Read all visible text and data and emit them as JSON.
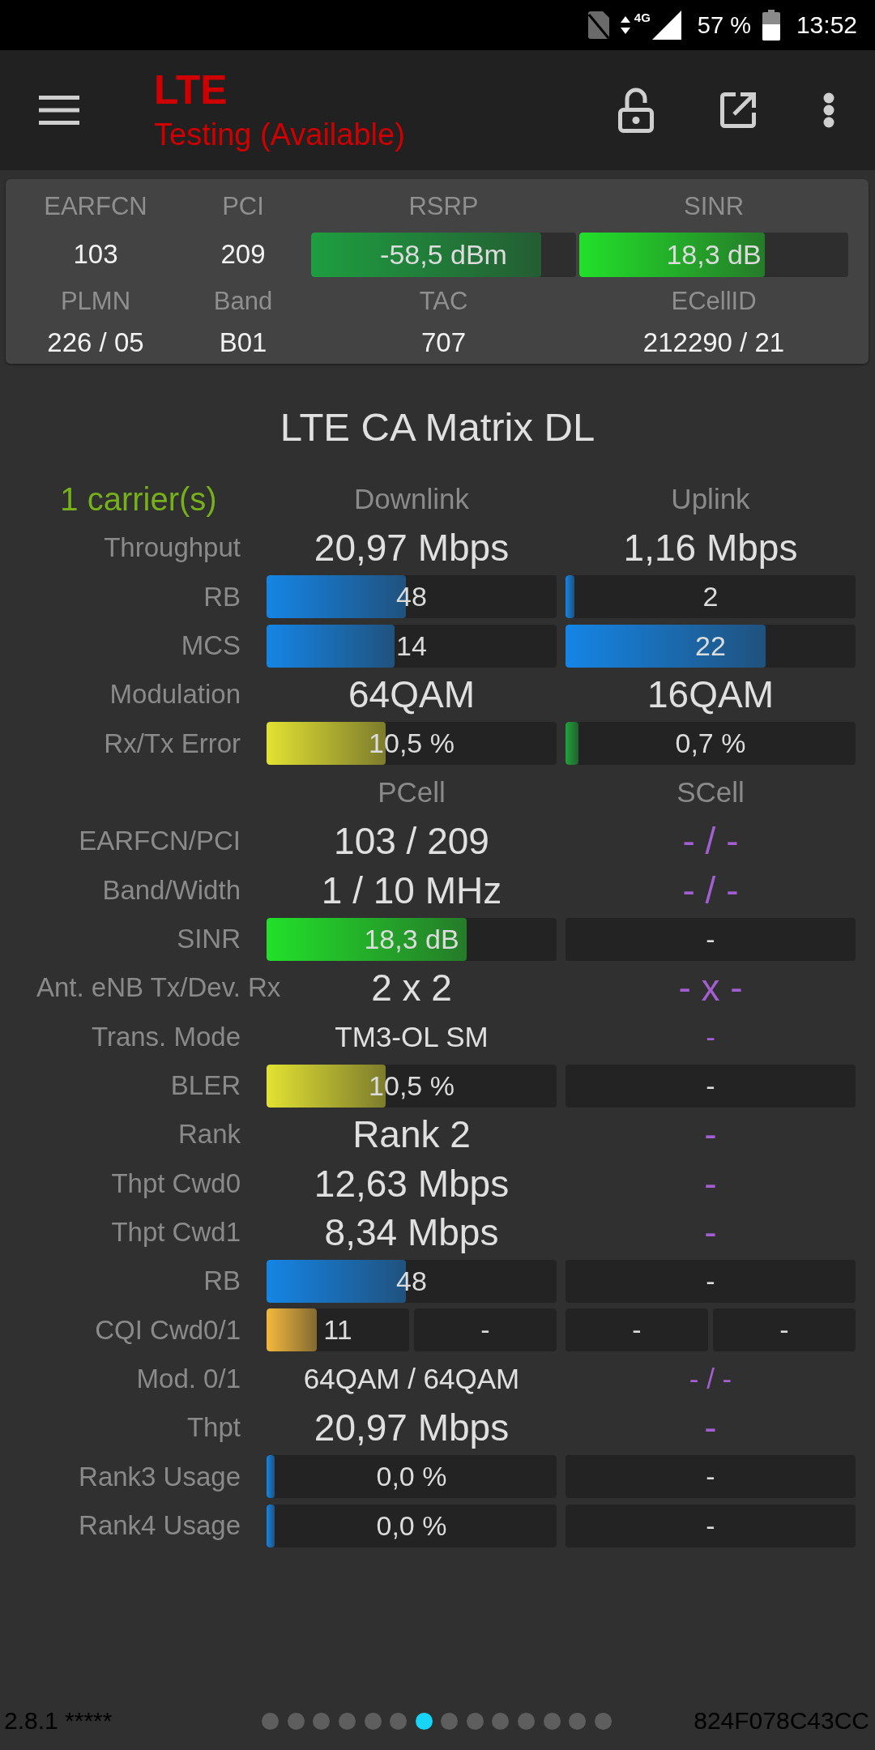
{
  "status_bar": {
    "network_type": "4G",
    "battery": "57 %",
    "time": "13:52"
  },
  "app_bar": {
    "title": "LTE",
    "subtitle": "Testing (Available)"
  },
  "cell_info": [
    {
      "label": "EARFCN",
      "kind": "text",
      "value": "103"
    },
    {
      "label": "PCI",
      "kind": "text",
      "value": "209"
    },
    {
      "label": "RSRP",
      "kind": "bar",
      "value": "-58,5 dBm",
      "level": 0.87,
      "color": "#1e9e40"
    },
    {
      "label": "SINR",
      "kind": "bar",
      "value": "18,3 dB",
      "level": 0.69,
      "color": "#22e02a"
    },
    {
      "label": "PLMN",
      "kind": "text",
      "value": "226 / 05"
    },
    {
      "label": "Band",
      "kind": "text",
      "value": "B01"
    },
    {
      "label": "TAC",
      "kind": "text",
      "value": "707"
    },
    {
      "label": "ECellID",
      "kind": "text",
      "value": "212290 / 21"
    }
  ],
  "matrix": {
    "title": "LTE CA Matrix DL",
    "rows": [
      {
        "kind": "heading",
        "label": "1 carrier(s)",
        "cells": [
          {
            "text": "Downlink"
          },
          {
            "text": "Uplink"
          }
        ]
      },
      {
        "kind": "large",
        "label": "Throughput",
        "cells": [
          {
            "text": "20,97 Mbps",
            "available": true
          },
          {
            "text": "1,16 Mbps",
            "available": true
          }
        ]
      },
      {
        "kind": "bar",
        "label": "RB",
        "cells": [
          {
            "text": "48",
            "level": 0.48,
            "color": "#1585e6"
          },
          {
            "text": "2",
            "level": 0.03,
            "color": "#1585e6"
          }
        ]
      },
      {
        "kind": "bar",
        "label": "MCS",
        "cells": [
          {
            "text": "14",
            "level": 0.44,
            "color": "#1585e6"
          },
          {
            "text": "22",
            "level": 0.69,
            "color": "#1585e6"
          }
        ]
      },
      {
        "kind": "large",
        "label": "Modulation",
        "cells": [
          {
            "text": "64QAM",
            "available": true
          },
          {
            "text": "16QAM",
            "available": true
          }
        ]
      },
      {
        "kind": "bar",
        "label": "Rx/Tx Error",
        "cells": [
          {
            "text": "10,5 %",
            "level": 0.41,
            "color": "#e3e232"
          },
          {
            "text": "0,7 %",
            "level": 0.045,
            "color": "#1fa33a"
          }
        ]
      },
      {
        "kind": "heading",
        "cells": [
          {
            "text": "PCell"
          },
          {
            "text": "SCell"
          }
        ]
      },
      {
        "kind": "large",
        "label": "EARFCN/PCI",
        "cells": [
          {
            "text": "103 / 209",
            "available": true
          },
          {
            "text": "- / -",
            "available": false
          }
        ]
      },
      {
        "kind": "large",
        "label": "Band/Width",
        "cells": [
          {
            "text": "1 / 10 MHz",
            "available": true
          },
          {
            "text": "- / -",
            "available": false
          }
        ]
      },
      {
        "kind": "bar",
        "label": "SINR",
        "cells": [
          {
            "text": "18,3 dB",
            "level": 0.69,
            "color": "#22e02a"
          },
          {
            "text": "-"
          }
        ]
      },
      {
        "kind": "large",
        "label": "Ant. eNB Tx/Dev. Rx",
        "cells": [
          {
            "text": "2 x 2",
            "available": true
          },
          {
            "text": "- x -",
            "available": false
          }
        ]
      },
      {
        "kind": "small",
        "label": "Trans. Mode",
        "cells": [
          {
            "text": "TM3-OL SM",
            "available": true
          },
          {
            "text": "-",
            "available": false
          }
        ]
      },
      {
        "kind": "bar",
        "label": "BLER",
        "cells": [
          {
            "text": "10,5 %",
            "level": 0.41,
            "color": "#e3e232"
          },
          {
            "text": "-"
          }
        ]
      },
      {
        "kind": "large",
        "label": "Rank",
        "cells": [
          {
            "text": "Rank 2",
            "available": true
          },
          {
            "text": "-",
            "available": false
          }
        ]
      },
      {
        "kind": "large",
        "label": "Thpt Cwd0",
        "cells": [
          {
            "text": "12,63 Mbps",
            "available": true
          },
          {
            "text": "-",
            "available": false
          }
        ]
      },
      {
        "kind": "large",
        "label": "Thpt Cwd1",
        "cells": [
          {
            "text": "8,34 Mbps",
            "available": true
          },
          {
            "text": "-",
            "available": false
          }
        ]
      },
      {
        "kind": "bar",
        "label": "RB",
        "cells": [
          {
            "text": "48",
            "level": 0.48,
            "color": "#1585e6"
          },
          {
            "text": "-"
          }
        ]
      },
      {
        "kind": "split",
        "label": "CQI Cwd0/1",
        "cells": [
          {
            "parts": [
              {
                "text": "11",
                "level": 0.35,
                "color": "#f4b93b"
              },
              {
                "text": "-"
              }
            ]
          },
          {
            "parts": [
              {
                "text": "-"
              },
              {
                "text": "-"
              }
            ]
          }
        ]
      },
      {
        "kind": "small",
        "label": "Mod. 0/1",
        "cells": [
          {
            "text": "64QAM / 64QAM",
            "available": true
          },
          {
            "text": "- / -",
            "available": false
          }
        ]
      },
      {
        "kind": "large",
        "label": "Thpt",
        "cells": [
          {
            "text": "20,97 Mbps",
            "available": true
          },
          {
            "text": "-",
            "available": false
          }
        ]
      },
      {
        "kind": "bar",
        "label": "Rank3 Usage",
        "cells": [
          {
            "text": "0,0 %",
            "level": 0.027,
            "color": "#1585e6"
          },
          {
            "text": "-"
          }
        ]
      },
      {
        "kind": "bar",
        "label": "Rank4 Usage",
        "cells": [
          {
            "text": "0,0 %",
            "level": 0.027,
            "color": "#1585e6"
          },
          {
            "text": "-"
          }
        ]
      }
    ]
  },
  "footer": {
    "version": "2.8.1 *****",
    "pages": [
      {
        "selected": false
      },
      {
        "selected": false
      },
      {
        "selected": false
      },
      {
        "selected": false
      },
      {
        "selected": false
      },
      {
        "selected": false
      },
      {
        "selected": true
      },
      {
        "selected": false
      },
      {
        "selected": false
      },
      {
        "selected": false
      },
      {
        "selected": false
      },
      {
        "selected": false
      },
      {
        "selected": false
      },
      {
        "selected": false
      }
    ],
    "device_id": "824F078C43CC"
  }
}
